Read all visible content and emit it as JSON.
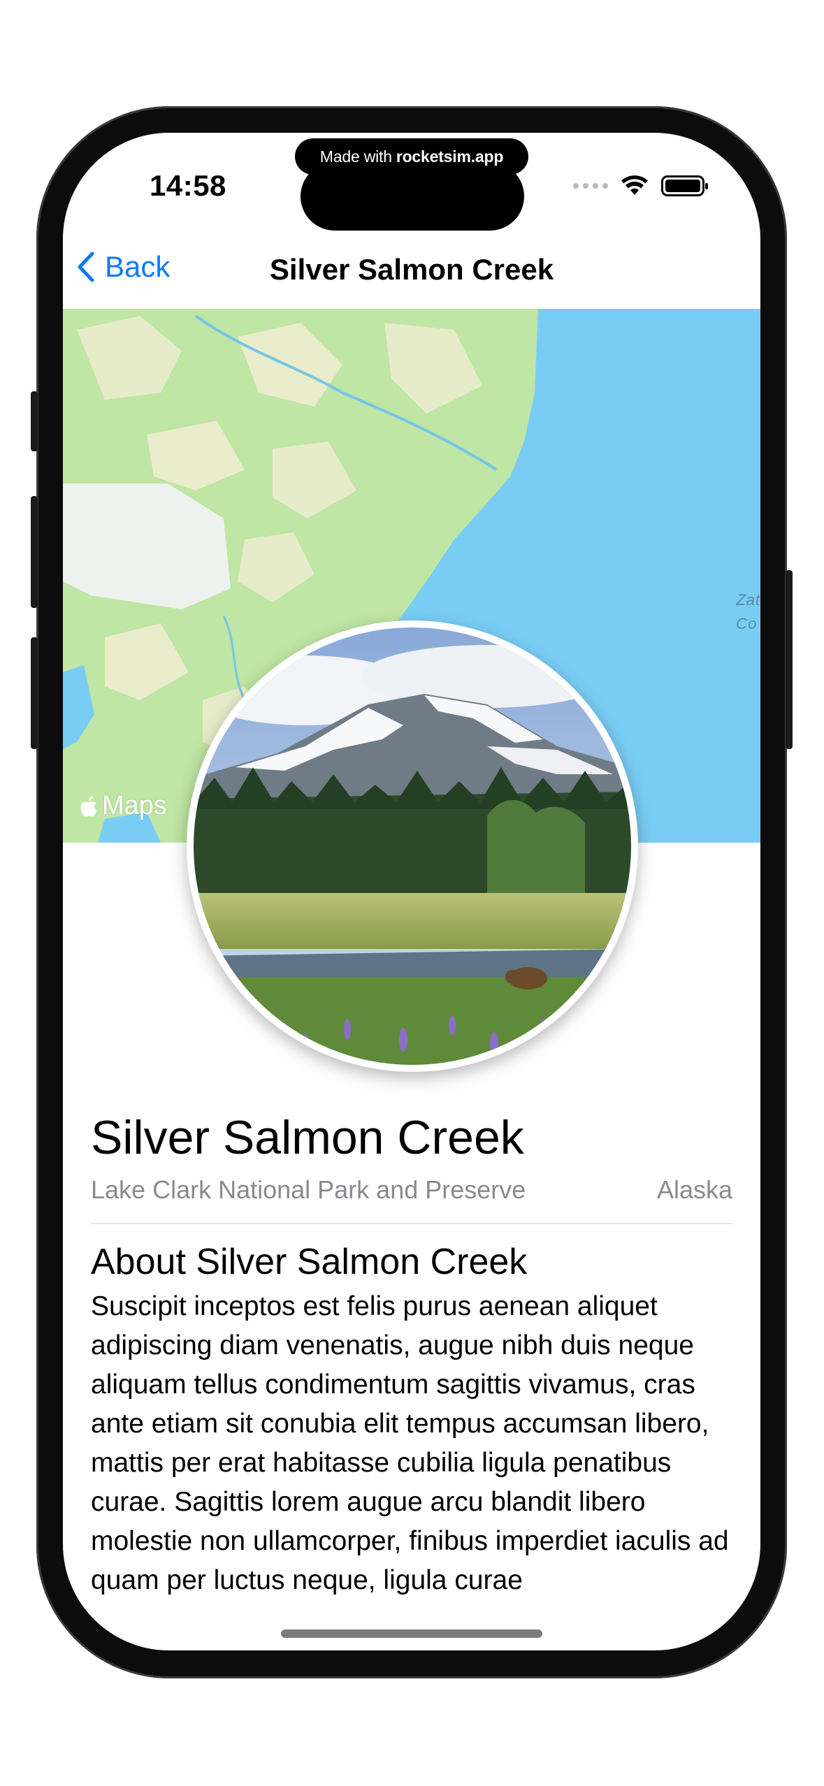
{
  "status_bar": {
    "time": "14:58",
    "badge_prefix": "Made with",
    "badge_brand": "rocketsim.app"
  },
  "nav": {
    "back_label": "Back",
    "title": "Silver Salmon Creek"
  },
  "map": {
    "attribution": "Maps",
    "partial_label_line1": "Zat",
    "partial_label_line2": "Co",
    "water_color": "#79cdf5",
    "land_color": "#bfe6a4"
  },
  "landmark": {
    "name": "Silver Salmon Creek",
    "park": "Lake Clark National Park and Preserve",
    "state": "Alaska",
    "about_heading": "About Silver Salmon Creek",
    "description": "Suscipit inceptos est felis purus aenean aliquet adipiscing diam venenatis, augue nibh duis neque aliquam tellus condimentum sagittis vivamus, cras ante etiam sit conubia elit tempus accumsan libero, mattis per erat habitasse cubilia ligula penatibus curae. Sagittis lorem augue arcu blandit libero molestie non ullamcorper, finibus imperdiet iaculis ad quam per luctus neque, ligula curae"
  },
  "colors": {
    "accent": "#0a7aff",
    "secondary_text": "#8a8a8e"
  }
}
